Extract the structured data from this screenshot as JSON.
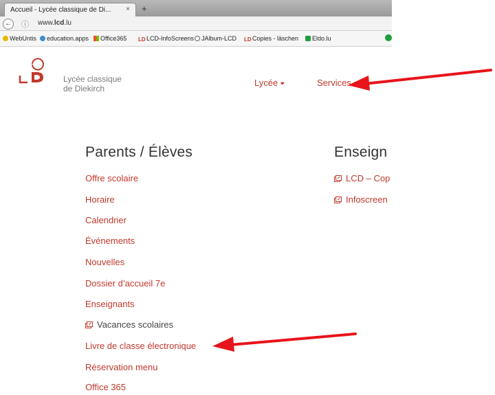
{
  "browser": {
    "tab_title": "Accueil - Lycée classique de Di...",
    "tab_close": "×",
    "new_tab": "+",
    "back": "←",
    "info": "ⓘ",
    "url_prefix": "www.",
    "url_domain": "lcd",
    "url_suffix": ".lu",
    "bookmarks": [
      {
        "label": "WebUntis",
        "icon": "webuntis-icon",
        "color": "#e8b800"
      },
      {
        "label": "education.apps",
        "icon": "education-icon",
        "color": "#3d8fd1"
      },
      {
        "label": "Office365",
        "icon": "office-icon",
        "color": "#f25022"
      },
      {
        "label": "LCD-InfoScreens",
        "icon": "lcd-icon",
        "color": "#c0392b"
      },
      {
        "label": "JAlbum-LCD",
        "icon": "jalbum-icon",
        "color": "#666666"
      },
      {
        "label": "Copies - läschen",
        "icon": "lcd-icon",
        "color": "#c0392b"
      },
      {
        "label": "Eldo.lu",
        "icon": "eldo-icon",
        "color": "#1e9e3e"
      }
    ]
  },
  "site": {
    "logo_text": "LCD",
    "school_line1": "Lycée classique",
    "school_line2": "de Diekirch",
    "nav": [
      {
        "label": "Lycée",
        "caret": "❤"
      },
      {
        "label": "Services",
        "caret": "❤"
      }
    ],
    "accent_color": "#c0392b"
  },
  "menu": {
    "col1_heading": "Parents / Élèves",
    "col1_links": [
      {
        "label": "Offre scolaire",
        "external": false
      },
      {
        "label": "Horaire",
        "external": false
      },
      {
        "label": "Calendrier",
        "external": false
      },
      {
        "label": "Événements",
        "external": false
      },
      {
        "label": "Nouvelles",
        "external": false
      },
      {
        "label": "Dossier d’accueil 7e",
        "external": false
      },
      {
        "label": "Enseignants",
        "external": false
      },
      {
        "label": "Vacances scolaires",
        "external": true
      },
      {
        "label": "Livre de classe électronique",
        "external": false
      },
      {
        "label": "Réservation menu",
        "external": false
      },
      {
        "label": "Office 365",
        "external": false
      }
    ],
    "col2_heading": "Enseign",
    "col2_links": [
      {
        "label": "LCD – Cop",
        "external": true
      },
      {
        "label": "Infoscreen",
        "external": true
      }
    ]
  },
  "annotations": {
    "arrow_color": "#e8141b",
    "arrows": [
      "services-arrow",
      "livre-de-classe-arrow"
    ]
  }
}
